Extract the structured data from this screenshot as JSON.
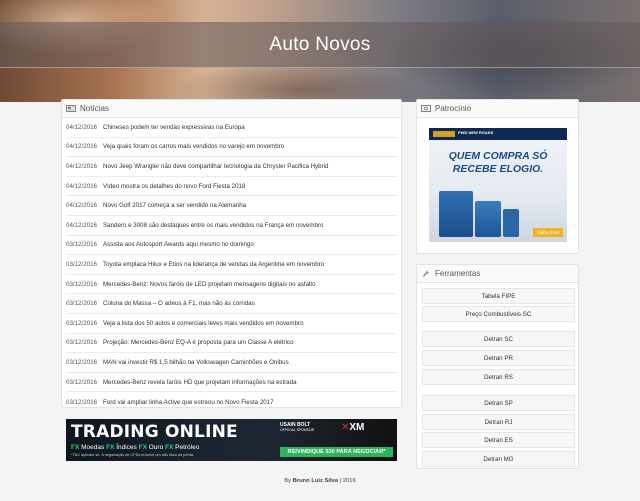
{
  "header": {
    "title": "Auto Novos"
  },
  "news": {
    "heading": "Notícias",
    "items": [
      {
        "date": "04/12/2016",
        "title": "Chineses podem ter vendas expressivas na Europa"
      },
      {
        "date": "04/12/2016",
        "title": "Veja quais foram os carros mais vendidos no varejo em novembro"
      },
      {
        "date": "04/12/2016",
        "title": "Novo Jeep Wrangler não deve compartilhar tecnologia da Chrysler Pacifica Hybrid"
      },
      {
        "date": "04/12/2016",
        "title": "Vídeo mostra os detalhes do novo Ford Fiesta 2018"
      },
      {
        "date": "04/12/2016",
        "title": "Novo Golf 2017 começa a ser vendido na Alemanha"
      },
      {
        "date": "04/12/2016",
        "title": "Sandero e 3008 são destaques entre os mais vendidos na França em novembro"
      },
      {
        "date": "03/12/2016",
        "title": "Assista aos Autosport Awards aqui mesmo no domingo"
      },
      {
        "date": "03/12/2016",
        "title": "Toyota emplaca Hilux e Etios na liderança de vendas da Argentina em novembro"
      },
      {
        "date": "03/12/2016",
        "title": "Mercedes-Benz: Novos faróis de LED projetam mensagens digitais no asfalto"
      },
      {
        "date": "03/12/2016",
        "title": "Coluna do Massa – O adeus à F1, mas não às corridas"
      },
      {
        "date": "03/12/2016",
        "title": "Veja a lista dos 50 autos e comerciais leves mais vendidos em novembro"
      },
      {
        "date": "03/12/2016",
        "title": "Projeção: Mercedes-Benz EQ-A é proposta para um Classe A elétrico"
      },
      {
        "date": "03/12/2016",
        "title": "MAN vai investir R$ 1,5 bilhão na Volkswagen Caminhões e Ônibus"
      },
      {
        "date": "03/12/2016",
        "title": "Mercedes-Benz revela faróis HD que projetam informações na estrada"
      },
      {
        "date": "03/12/2016",
        "title": "Ford vai ampliar linha Active que estreou no Novo Fiesta 2017"
      }
    ]
  },
  "sponsor": {
    "heading": "Patrocínio",
    "ad": {
      "brand": "FIND NEW ROADS",
      "headline_line1": "QUEM COMPRA SÓ",
      "headline_line2": "RECEBE ELOGIO.",
      "button": "Saiba mais"
    }
  },
  "tools": {
    "heading": "Ferramentas",
    "items": [
      "Tabela FIPE",
      "Preço Combustíveis SC",
      "Detran SC",
      "Detran PR",
      "Detran RS",
      "Detran SP",
      "Detran RJ",
      "Detran ES",
      "Detran MG"
    ]
  },
  "trading_ad": {
    "title": "TRADING ONLINE",
    "fx": "FX",
    "items": [
      "Moedas",
      "Índices",
      "Ouro",
      "Petróleo"
    ],
    "note": "*T&C aplicam-se. A negociação de CFDs envolve um alto risco de perda.",
    "usain": "USAIN BOLT",
    "sponsor_label": "OFFICIAL SPONSOR",
    "xm": "XM",
    "cta": "REIVINDIQUE $30 PARA NEGOCIAR*"
  },
  "footer": {
    "prefix": "By",
    "author": "Bruno Luiz Silva",
    "year": "| 2016"
  },
  "colors": {
    "accent_blue": "#1a4c86",
    "cta_green": "#2fb35b",
    "ad_yellow": "#f0b323"
  }
}
